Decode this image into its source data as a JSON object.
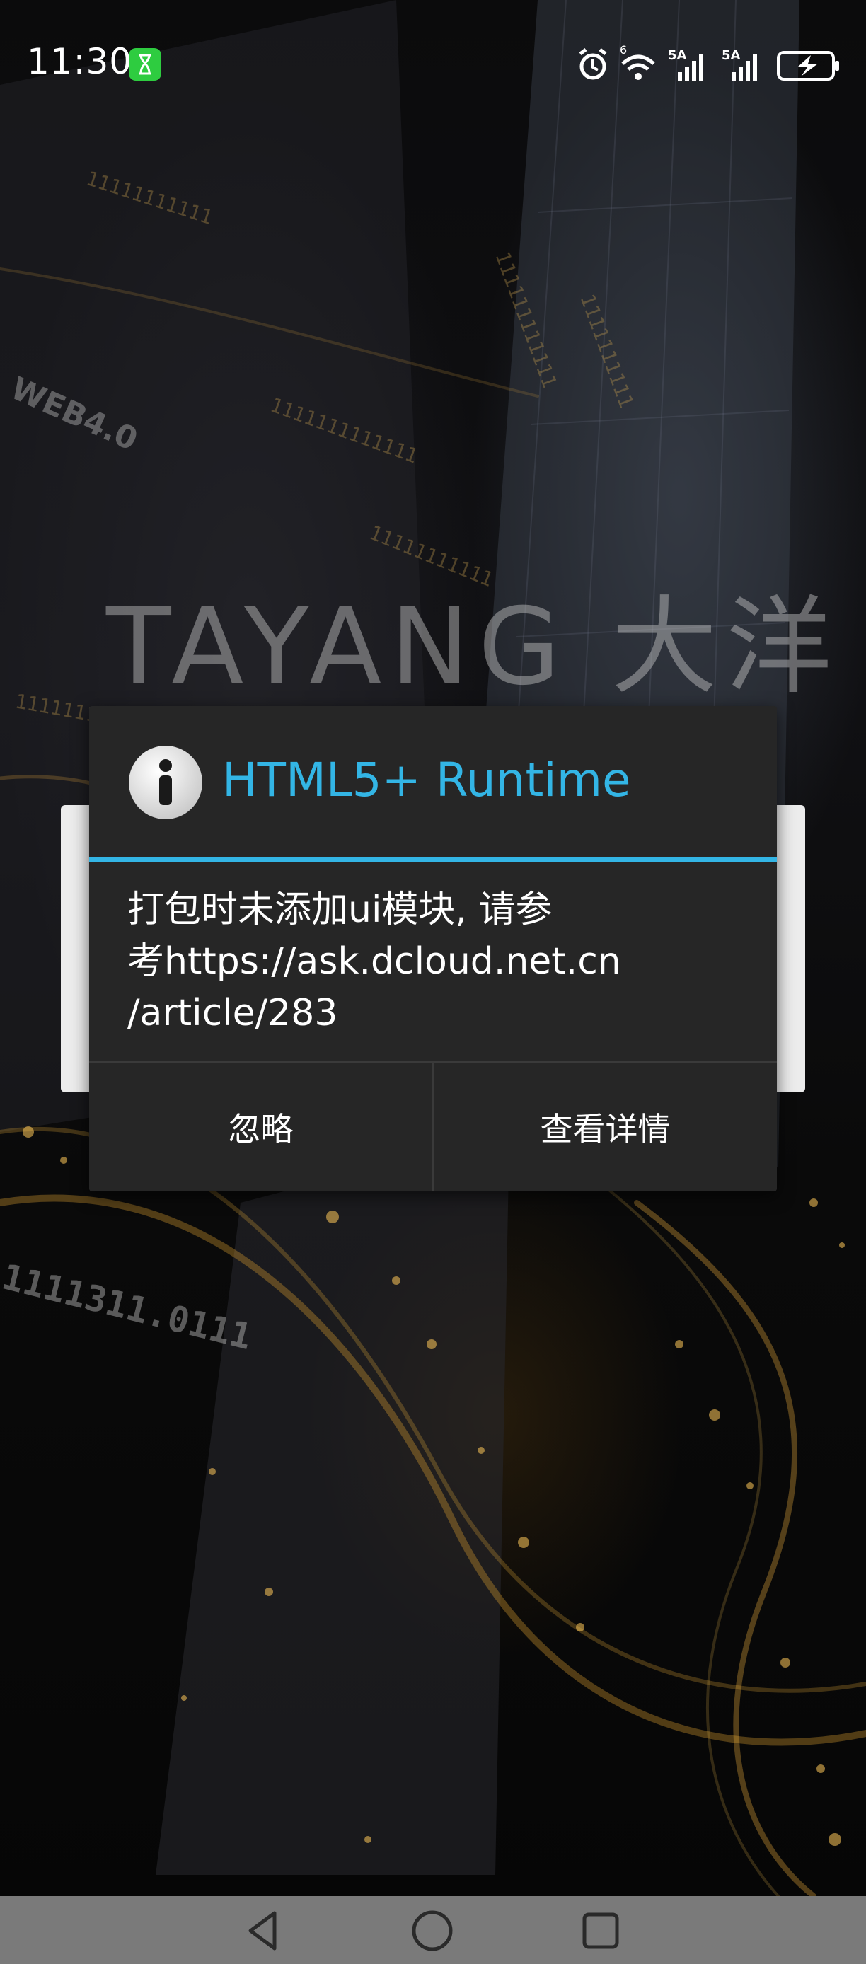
{
  "status_bar": {
    "time": "11:30",
    "network_sim1": "5A",
    "network_sim2": "5A",
    "wifi_badge": "6"
  },
  "background": {
    "logo_text": "TAYANG 大洋",
    "tag_text": "WEB4.0",
    "code_digits": "1111311.0111"
  },
  "dialog": {
    "title": "HTML5+ Runtime",
    "message": "打包时未添加ui模块, 请参\n考https://ask.dcloud.net.cn\n/article/283",
    "buttons": {
      "ignore": "忽略",
      "details": "查看详情"
    },
    "accent_color": "#33b5e5"
  },
  "nav_bar": {
    "icons": [
      "back-icon",
      "home-icon",
      "recent-apps-icon"
    ]
  }
}
